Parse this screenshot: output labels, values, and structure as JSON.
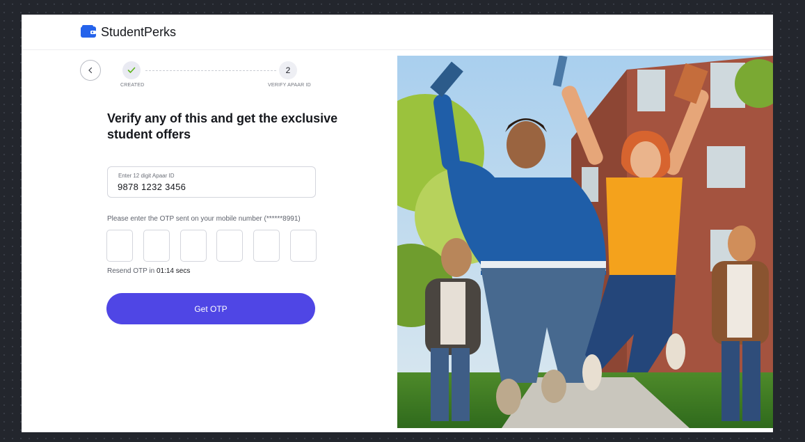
{
  "header": {
    "brand": "StudentPerks",
    "logo_icon": "wallet-icon"
  },
  "stepper": {
    "steps": [
      {
        "label": "CREATED",
        "state": "completed",
        "icon": "check-icon"
      },
      {
        "label": "VERIFY APAAR ID",
        "state": "current",
        "number": "2"
      }
    ]
  },
  "form": {
    "heading": "Verify any of this and get the exclusive student offers",
    "apaar": {
      "label": "Enter 12 digit Apaar ID",
      "value": "9878 1232 3456"
    },
    "otp": {
      "instruction": "Please enter the OTP sent on your mobile number (******8991)",
      "digits": [
        "",
        "",
        "",
        "",
        "",
        ""
      ],
      "resend_prefix": "Resend OTP in",
      "resend_timer": "01:14 secs"
    },
    "submit_label": "Get OTP"
  },
  "colors": {
    "accent": "#4f46e5",
    "brand_icon": "#2563eb",
    "check": "#5bb318"
  }
}
